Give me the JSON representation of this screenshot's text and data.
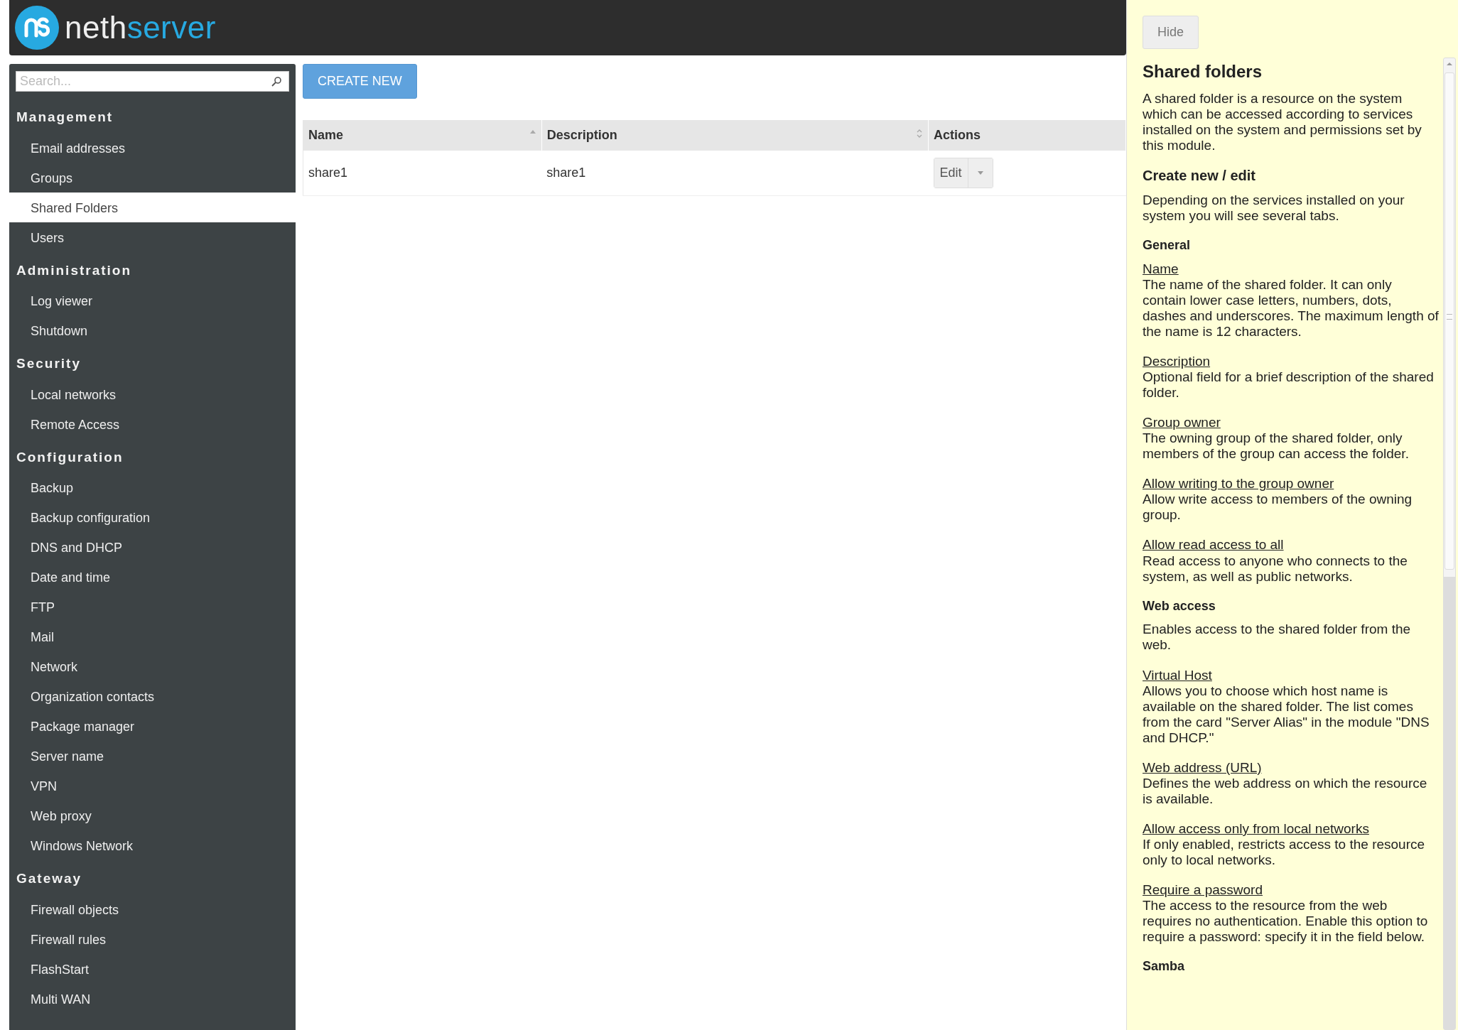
{
  "brand": {
    "first": "neth",
    "second": "server"
  },
  "sidebar": {
    "search": {
      "placeholder": "Search..."
    },
    "groups": [
      {
        "title": "Management",
        "items": [
          {
            "label": "Email addresses",
            "selected": false
          },
          {
            "label": "Groups",
            "selected": false
          },
          {
            "label": "Shared Folders",
            "selected": true
          },
          {
            "label": "Users",
            "selected": false
          }
        ]
      },
      {
        "title": "Administration",
        "items": [
          {
            "label": "Log viewer",
            "selected": false
          },
          {
            "label": "Shutdown",
            "selected": false
          }
        ]
      },
      {
        "title": "Security",
        "items": [
          {
            "label": "Local networks",
            "selected": false
          },
          {
            "label": "Remote Access",
            "selected": false
          }
        ]
      },
      {
        "title": "Configuration",
        "items": [
          {
            "label": "Backup",
            "selected": false
          },
          {
            "label": "Backup configuration",
            "selected": false
          },
          {
            "label": "DNS and DHCP",
            "selected": false
          },
          {
            "label": "Date and time",
            "selected": false
          },
          {
            "label": "FTP",
            "selected": false
          },
          {
            "label": "Mail",
            "selected": false
          },
          {
            "label": "Network",
            "selected": false
          },
          {
            "label": "Organization contacts",
            "selected": false
          },
          {
            "label": "Package manager",
            "selected": false
          },
          {
            "label": "Server name",
            "selected": false
          },
          {
            "label": "VPN",
            "selected": false
          },
          {
            "label": "Web proxy",
            "selected": false
          },
          {
            "label": "Windows Network",
            "selected": false
          }
        ]
      },
      {
        "title": "Gateway",
        "items": [
          {
            "label": "Firewall objects",
            "selected": false
          },
          {
            "label": "Firewall rules",
            "selected": false
          },
          {
            "label": "FlashStart",
            "selected": false
          },
          {
            "label": "Multi WAN",
            "selected": false
          }
        ]
      }
    ]
  },
  "create_button": "CREATE NEW",
  "table": {
    "columns": [
      {
        "label": "Name",
        "sortable": true,
        "sorted": true
      },
      {
        "label": "Description",
        "sortable": true,
        "sorted": false
      },
      {
        "label": "Actions",
        "sortable": false
      }
    ],
    "rows": [
      {
        "name": "share1",
        "description": "share1",
        "action": "Edit"
      }
    ]
  },
  "help": {
    "hide_button": "Hide",
    "title": "Shared folders",
    "blocks": [
      {
        "kind": "paragraph",
        "text": "A shared folder is a resource on the system which can be accessed according to services installed on the system and permissions set by this module."
      },
      {
        "kind": "heading",
        "text": "Create new / edit"
      },
      {
        "kind": "paragraph",
        "text": "Depending on the services installed on your system you will see several tabs."
      },
      {
        "kind": "subheading",
        "text": "General"
      },
      {
        "kind": "term",
        "term": "Name",
        "text": "The name of the shared folder. It can only contain lower case letters, numbers, dots, dashes and underscores. The maximum length of the name is 12 characters."
      },
      {
        "kind": "term",
        "term": "Description",
        "text": "Optional field for a brief description of the shared folder."
      },
      {
        "kind": "term",
        "term": "Group owner",
        "text": "The owning group of the shared folder, only members of the group can access the folder."
      },
      {
        "kind": "term",
        "term": "Allow writing to the group owner",
        "text": "Allow write access to members of the owning group."
      },
      {
        "kind": "term",
        "term": "Allow read access to all",
        "text": "Read access to anyone who connects to the system, as well as public networks."
      },
      {
        "kind": "subheading",
        "text": "Web access"
      },
      {
        "kind": "paragraph",
        "text": "Enables access to the shared folder from the web."
      },
      {
        "kind": "term",
        "term": "Virtual Host",
        "text": "Allows you to choose which host name is available on the shared folder. The list comes from the card \"Server Alias\" in the module \"DNS and DHCP.\""
      },
      {
        "kind": "term",
        "term": "Web address (URL)",
        "text": "Defines the web address on which the resource is available."
      },
      {
        "kind": "term",
        "term": "Allow access only from local networks",
        "text": "If only enabled, restricts access to the resource only to local networks."
      },
      {
        "kind": "term",
        "term": "Require a password",
        "text": "The access to the resource from the web requires no authentication. Enable this option to require a password: specify it in the field below."
      },
      {
        "kind": "subheading",
        "text": "Samba"
      }
    ]
  }
}
